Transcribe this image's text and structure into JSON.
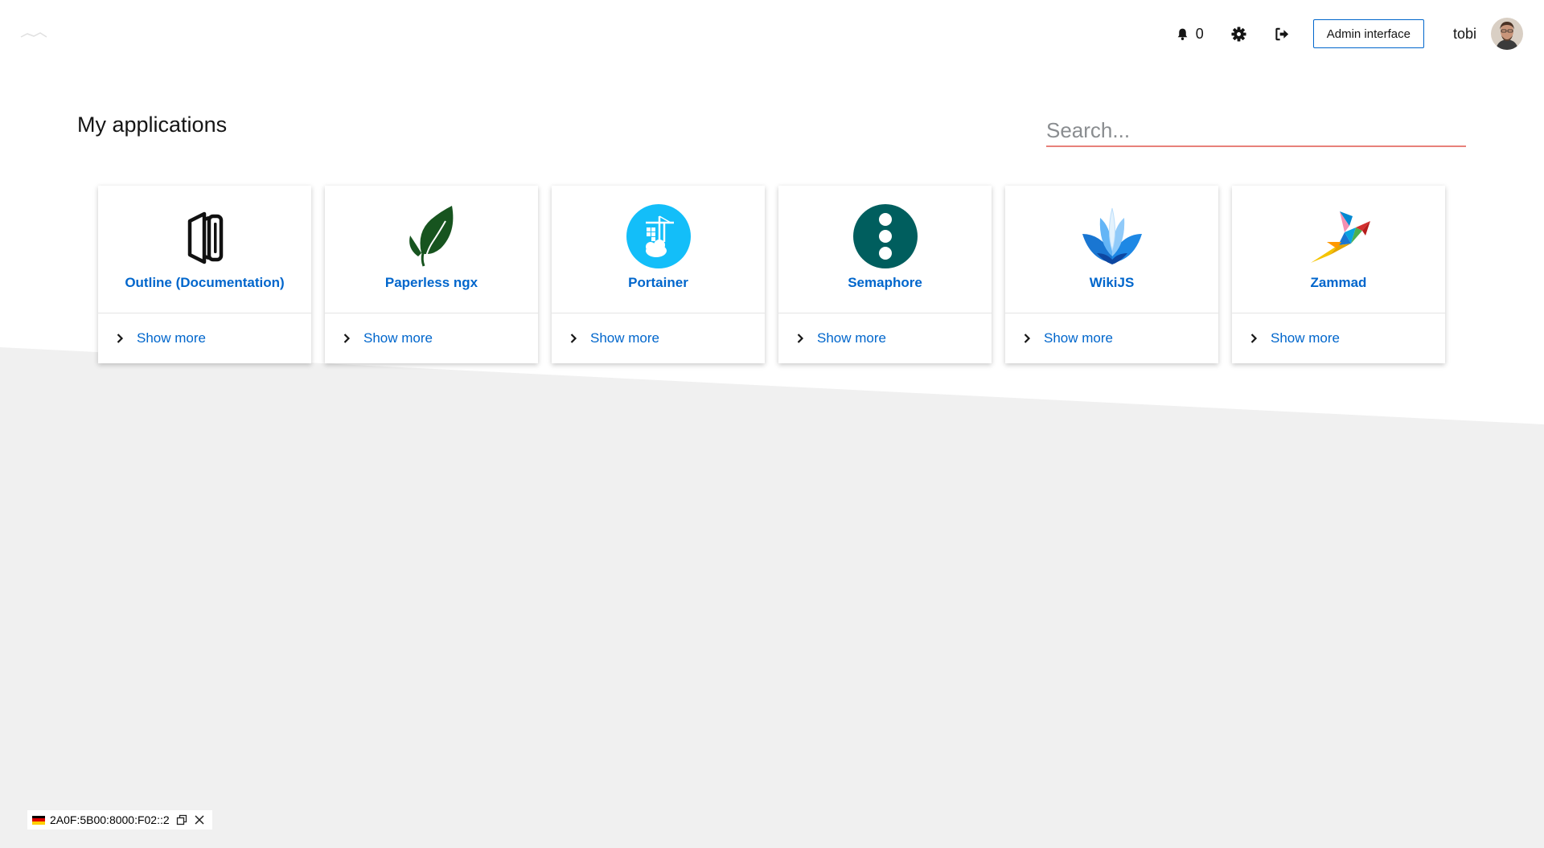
{
  "header": {
    "notification_count": "0",
    "admin_label": "Admin interface",
    "username": "tobi"
  },
  "main": {
    "title": "My applications",
    "search_placeholder": "Search..."
  },
  "apps": [
    {
      "name": "Outline (Documentation)",
      "icon": "outline-logo-icon",
      "show_more": "Show more"
    },
    {
      "name": "Paperless ngx",
      "icon": "leaf-logo-icon",
      "show_more": "Show more"
    },
    {
      "name": "Portainer",
      "icon": "portainer-logo-icon",
      "show_more": "Show more"
    },
    {
      "name": "Semaphore",
      "icon": "semaphore-logo-icon",
      "show_more": "Show more"
    },
    {
      "name": "WikiJS",
      "icon": "wikijs-logo-icon",
      "show_more": "Show more"
    },
    {
      "name": "Zammad",
      "icon": "zammad-logo-icon",
      "show_more": "Show more"
    }
  ],
  "ip_bar": {
    "address": "2A0F:5B00:8000:F02::2"
  },
  "colors": {
    "accent": "#0066cc",
    "search_underline": "#e8817a",
    "background_gray": "#f0f0f0"
  }
}
